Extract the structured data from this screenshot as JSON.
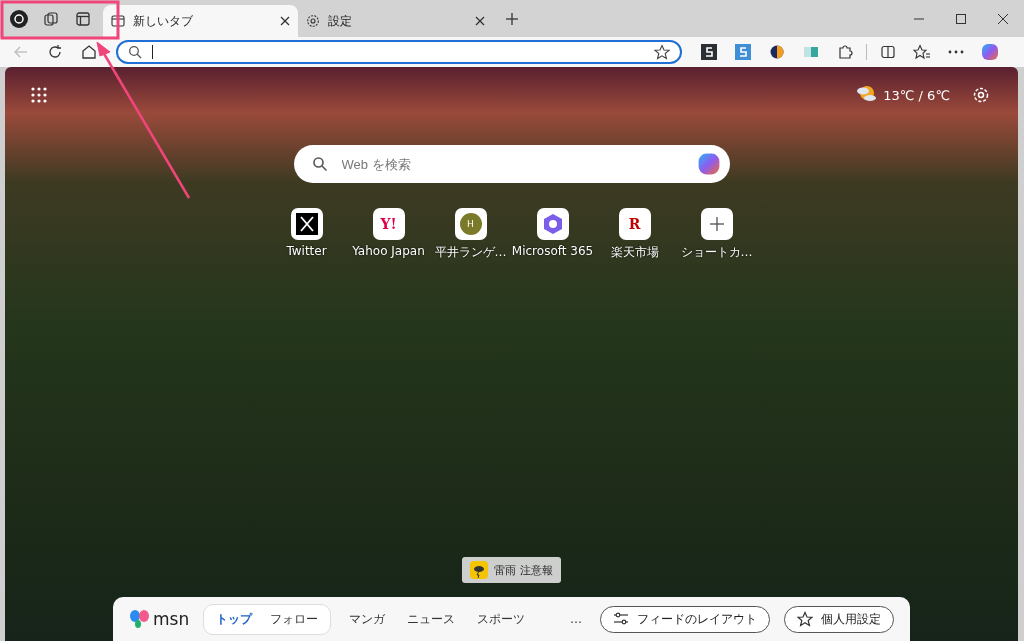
{
  "tabs": [
    {
      "label": "新しいタブ",
      "selected": true,
      "kind": "newtab"
    },
    {
      "label": "設定",
      "selected": false,
      "kind": "settings"
    }
  ],
  "extensions": [
    {
      "kind": "s-dark"
    },
    {
      "kind": "s-blue"
    },
    {
      "kind": "orb"
    },
    {
      "kind": "book"
    }
  ],
  "search": {
    "placeholder": "Web を検索"
  },
  "weather": {
    "reading": "13℃ / 6℃"
  },
  "shortcuts": [
    {
      "label": "Twitter",
      "kind": "x"
    },
    {
      "label": "Yahoo Japan",
      "kind": "text",
      "glyph": "Y!",
      "color": "#e0004a"
    },
    {
      "label": "平井ランゲ…",
      "kind": "circle",
      "glyph": "H",
      "color": "#7b7a2a"
    },
    {
      "label": "Microsoft 365",
      "kind": "m365"
    },
    {
      "label": "楽天市場",
      "kind": "text",
      "glyph": "R",
      "color": "#bf0000"
    },
    {
      "label": "ショートカ…",
      "kind": "add"
    }
  ],
  "alert": {
    "text": "雷雨 注意報"
  },
  "feed_bar": {
    "logo": "msn",
    "tabs": [
      {
        "label": "トップ",
        "selected": true
      },
      {
        "label": "フォロー",
        "selected": false
      }
    ],
    "links": [
      "マンガ",
      "ニュース",
      "スポーツ"
    ],
    "more": "…",
    "buttons": [
      {
        "label": "フィードのレイアウト",
        "kind": "layout"
      },
      {
        "label": "個人用設定",
        "kind": "personalize"
      }
    ]
  }
}
